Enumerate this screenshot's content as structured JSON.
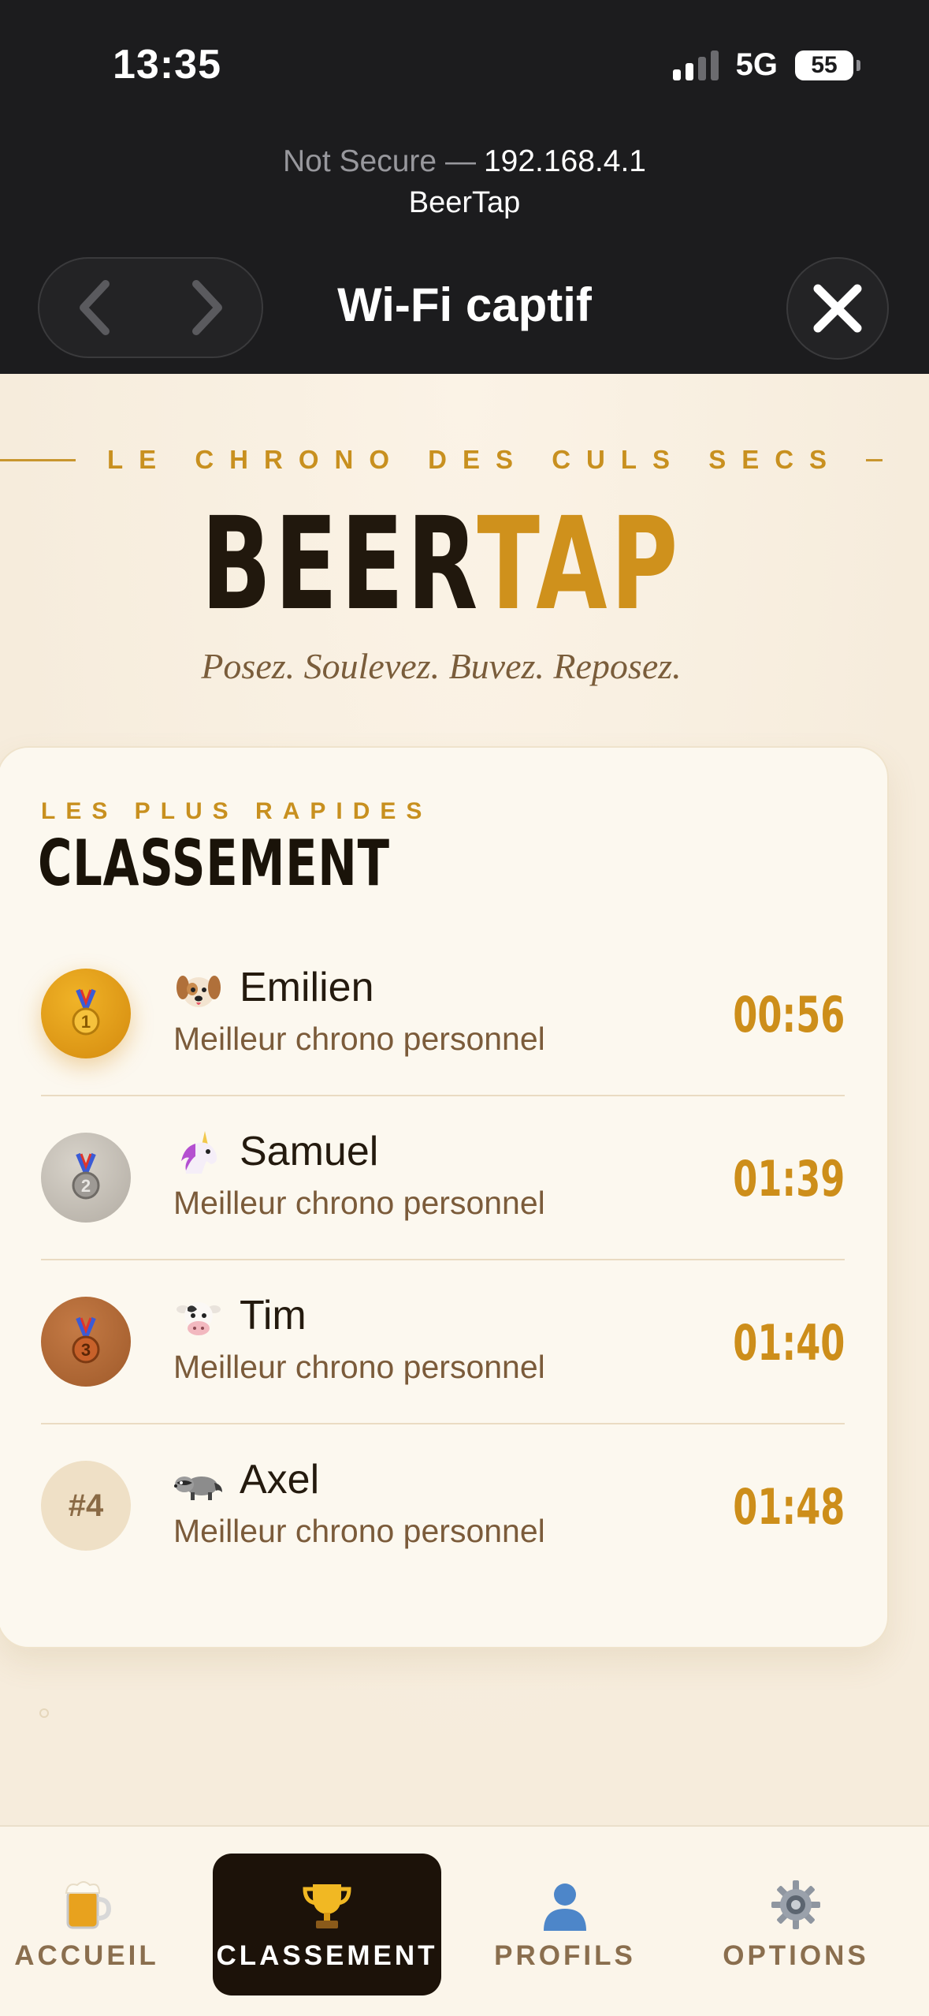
{
  "status_bar": {
    "time": "13:35",
    "network": "5G",
    "battery": "55"
  },
  "browser": {
    "not_secure": "Not Secure —",
    "host": "192.168.4.1",
    "site_name": "BeerTap",
    "title": "Wi-Fi captif"
  },
  "hero": {
    "kicker": "LE CHRONO DES CULS SECS",
    "brand_part1": "BEER",
    "brand_part2": "TAP",
    "tagline": "Posez. Soulevez. Buvez. Reposez."
  },
  "leaderboard": {
    "kicker": "LES PLUS RAPIDES",
    "title": "CLASSEMENT",
    "entries": [
      {
        "rank": "1",
        "medal": "gold-medal-icon",
        "avatar": "dog-icon",
        "name": "Emilien",
        "subtitle": "Meilleur chrono personnel",
        "time": "00:56"
      },
      {
        "rank": "2",
        "medal": "silver-medal-icon",
        "avatar": "unicorn-icon",
        "name": "Samuel",
        "subtitle": "Meilleur chrono personnel",
        "time": "01:39"
      },
      {
        "rank": "3",
        "medal": "bronze-medal-icon",
        "avatar": "cow-icon",
        "name": "Tim",
        "subtitle": "Meilleur chrono personnel",
        "time": "01:40"
      },
      {
        "rank": "#4",
        "medal": "none",
        "avatar": "raccoon-icon",
        "name": "Axel",
        "subtitle": "Meilleur chrono personnel",
        "time": "01:48"
      }
    ]
  },
  "tabs": [
    {
      "label": "ACCUEIL",
      "icon": "beer-mug-icon",
      "active": false
    },
    {
      "label": "CLASSEMENT",
      "icon": "trophy-icon",
      "active": true
    },
    {
      "label": "PROFILS",
      "icon": "person-icon",
      "active": false
    },
    {
      "label": "OPTIONS",
      "icon": "gear-icon",
      "active": false
    }
  ],
  "colors": {
    "accent": "#cf911c",
    "dark": "#1c1209",
    "background": "#f8efe1"
  }
}
